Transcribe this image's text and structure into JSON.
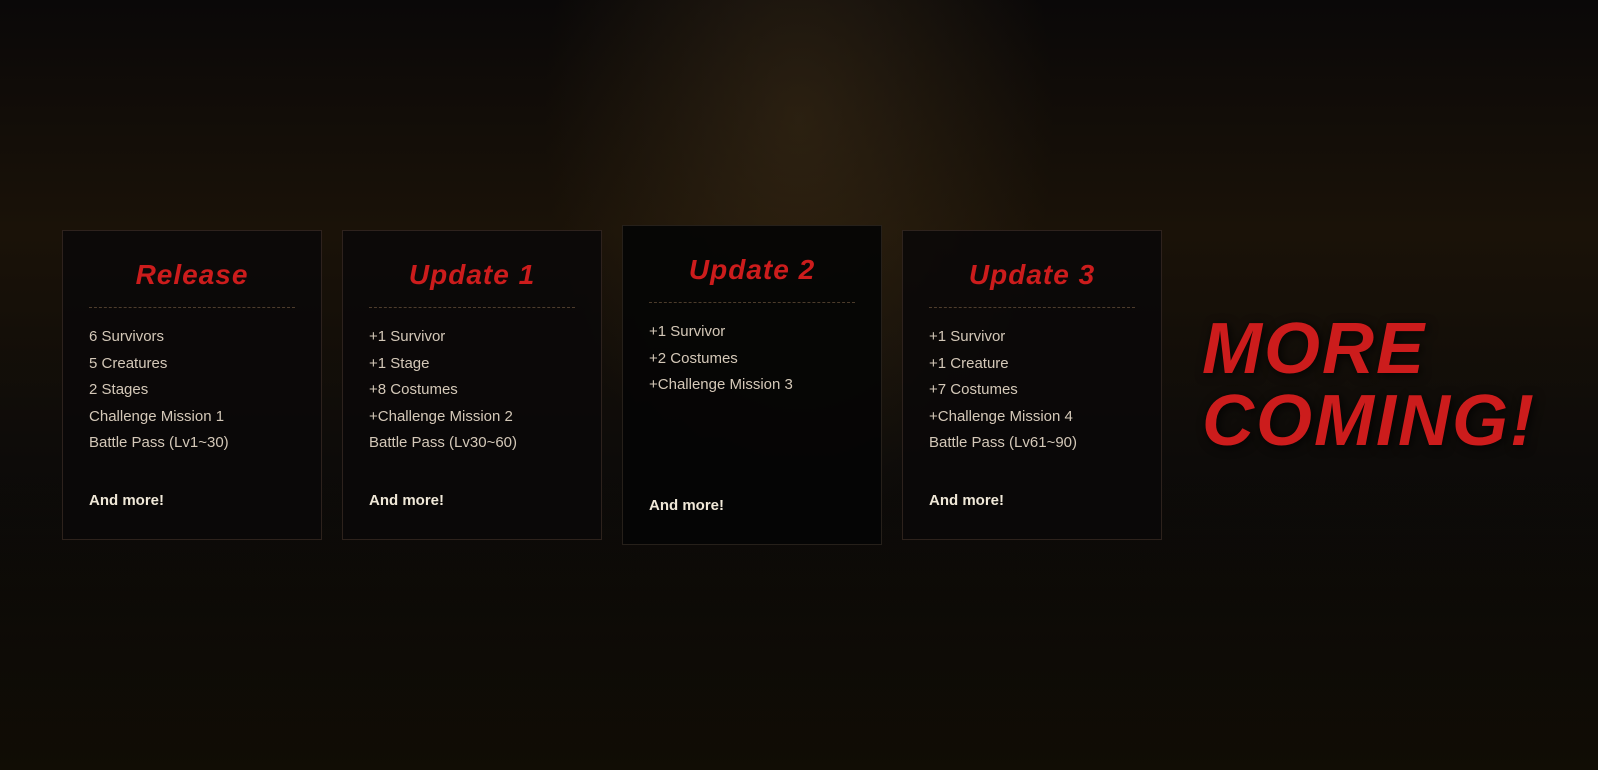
{
  "background": {
    "base_color": "#0a0808"
  },
  "cards": [
    {
      "id": "release",
      "title": "Release",
      "items": [
        "6 Survivors",
        "5 Creatures",
        "2 Stages",
        "Challenge Mission 1",
        "Battle Pass (Lv1~30)"
      ],
      "more": "And more!"
    },
    {
      "id": "update1",
      "title": "Update 1",
      "items": [
        "+1 Survivor",
        "+1 Stage",
        "+8 Costumes",
        "+Challenge Mission 2",
        "Battle Pass (Lv30~60)"
      ],
      "more": "And more!"
    },
    {
      "id": "update2",
      "title": "Update 2",
      "items": [
        "+1 Survivor",
        "+2 Costumes",
        "+Challenge Mission 3"
      ],
      "more": "And more!"
    },
    {
      "id": "update3",
      "title": "Update 3",
      "items": [
        "+1 Survivor",
        "+1 Creature",
        "+7 Costumes",
        "+Challenge Mission 4",
        "Battle Pass (Lv61~90)"
      ],
      "more": "And more!"
    }
  ],
  "more_coming": {
    "line1": "MORE",
    "line2": "COMING!"
  }
}
